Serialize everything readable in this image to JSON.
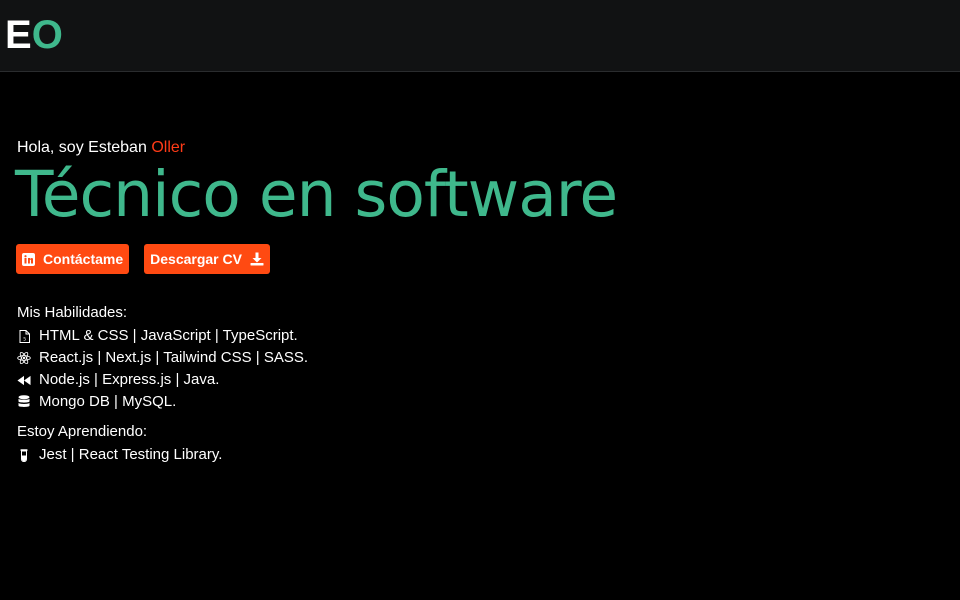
{
  "logo": {
    "letter1": "E",
    "letter2": "O"
  },
  "hero": {
    "greeting": "Hola, soy Esteban",
    "surname": "Oller",
    "headline": "Técnico en software"
  },
  "buttons": {
    "contact": {
      "label": "Contáctame",
      "icon": "linkedin-icon"
    },
    "cv": {
      "label": "Descargar CV",
      "icon": "download-icon"
    }
  },
  "skills": {
    "title": "Mis Habilidades:",
    "rows": [
      {
        "icon": "html-file-icon",
        "text": "HTML & CSS | JavaScript | TypeScript."
      },
      {
        "icon": "react-icon",
        "text": "React.js | Next.js | Tailwind CSS | SASS."
      },
      {
        "icon": "backward-icon",
        "text": "Node.js | Express.js | Java."
      },
      {
        "icon": "database-icon",
        "text": "Mongo DB | MySQL."
      }
    ],
    "learning_title": "Estoy Aprendiendo:",
    "learning_rows": [
      {
        "icon": "test-tube-icon",
        "text": "Jest | React Testing Library."
      }
    ]
  },
  "colors": {
    "accent_green": "#3fb88c",
    "accent_orange": "#ff4a12",
    "surname_red": "#ff3b17",
    "background": "#000000",
    "navbar": "#111213"
  }
}
